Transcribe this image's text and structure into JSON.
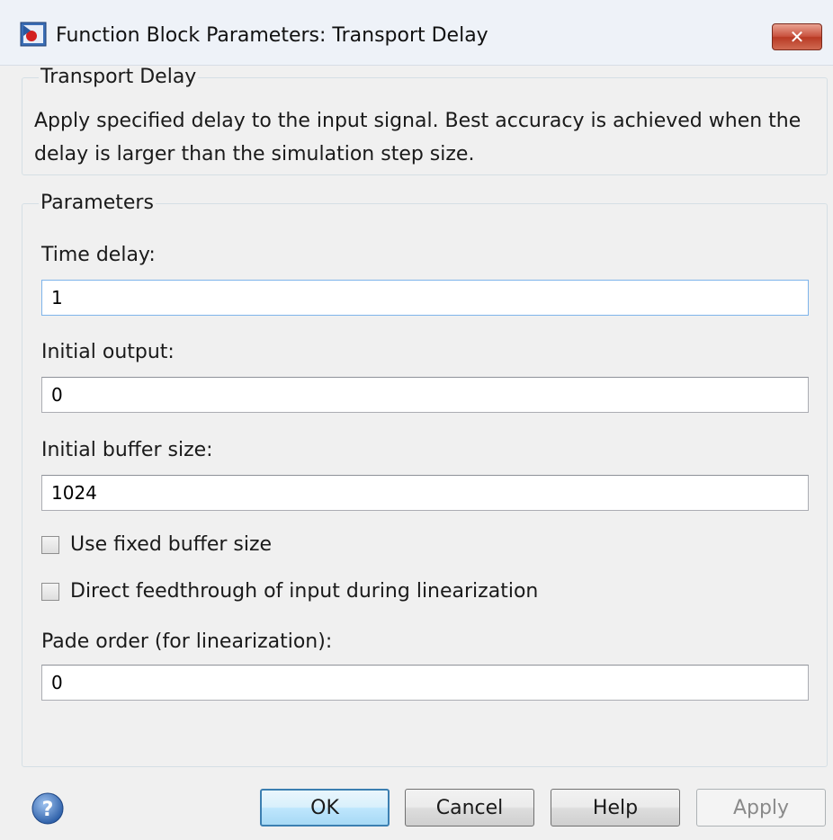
{
  "window": {
    "title": "Function Block Parameters: Transport Delay",
    "close_glyph": "✕"
  },
  "description": {
    "group_title": "Transport Delay",
    "text": "Apply specified delay to the input signal.  Best accuracy is achieved when the delay is larger than the simulation step size."
  },
  "parameters": {
    "group_title": "Parameters",
    "time_delay": {
      "label": "Time delay:",
      "value": "1"
    },
    "initial_output": {
      "label": "Initial output:",
      "value": "0"
    },
    "initial_buffer_size": {
      "label": "Initial buffer size:",
      "value": "1024"
    },
    "use_fixed_buffer": {
      "label": "Use fixed buffer size",
      "checked": false
    },
    "direct_feedthrough": {
      "label": "Direct feedthrough of input during linearization",
      "checked": false
    },
    "pade_order": {
      "label": "Pade order (for linearization):",
      "value": "0"
    }
  },
  "buttons": {
    "ok": "OK",
    "cancel": "Cancel",
    "help": "Help",
    "apply": "Apply"
  },
  "icons": {
    "app": "simulink-block-icon",
    "help": "help-question-icon",
    "close": "close-icon"
  }
}
